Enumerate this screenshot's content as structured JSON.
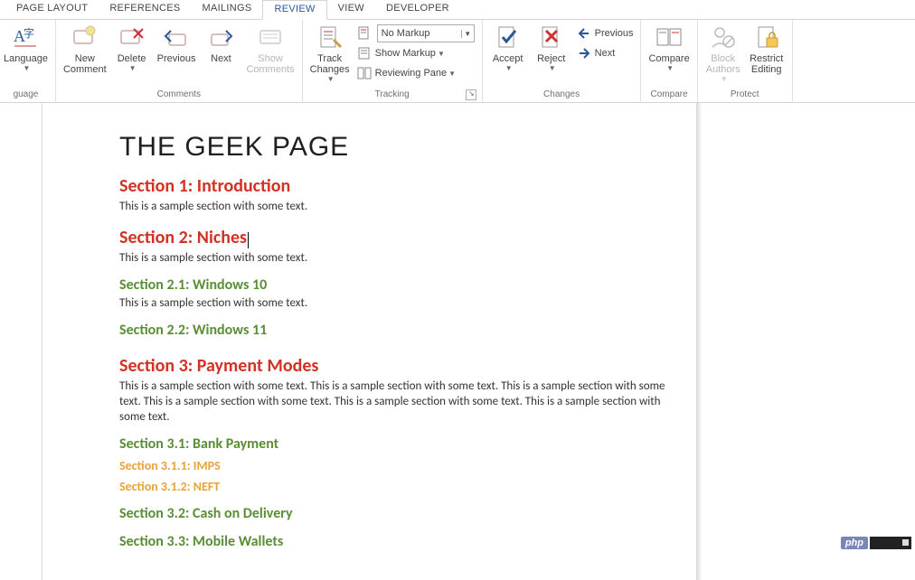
{
  "tabs": {
    "page_layout": "PAGE LAYOUT",
    "references": "REFERENCES",
    "mailings": "MAILINGS",
    "review": "REVIEW",
    "view": "VIEW",
    "developer": "DEVELOPER"
  },
  "ribbon": {
    "language": {
      "label": "Language",
      "group_partial": "guage"
    },
    "comments": {
      "new_comment": "New\nComment",
      "delete": "Delete",
      "previous": "Previous",
      "next": "Next",
      "show_comments": "Show\nComments",
      "group": "Comments"
    },
    "tracking": {
      "track_changes": "Track\nChanges",
      "display_combo": "No Markup",
      "show_markup": "Show Markup",
      "reviewing_pane": "Reviewing Pane",
      "group": "Tracking"
    },
    "changes": {
      "accept": "Accept",
      "reject": "Reject",
      "previous": "Previous",
      "next": "Next",
      "group": "Changes"
    },
    "compare": {
      "compare": "Compare",
      "group": "Compare"
    },
    "protect": {
      "block_authors": "Block\nAuthors",
      "restrict_editing": "Restrict\nEditing",
      "group": "Protect"
    }
  },
  "document": {
    "title": "THE GEEK PAGE",
    "sample_text": "This is a sample section with some text.",
    "sample_long": "This is a sample section with some text. This is a sample section with some text. This is a sample section with some text. This is a sample section with some text. This is a sample section with some text. This is a sample section with some text.",
    "sections": {
      "s1": "Section 1: Introduction",
      "s2": "Section 2: Niches",
      "s21": "Section 2.1: Windows 10",
      "s22": "Section 2.2: Windows 11",
      "s3": "Section 3: Payment Modes",
      "s31": "Section 3.1: Bank Payment",
      "s311": "Section 3.1.1: IMPS",
      "s312": "Section 3.1.2: NEFT",
      "s32": "Section 3.2: Cash on Delivery",
      "s33": "Section 3.3: Mobile Wallets"
    }
  },
  "badge": {
    "php": "php"
  }
}
